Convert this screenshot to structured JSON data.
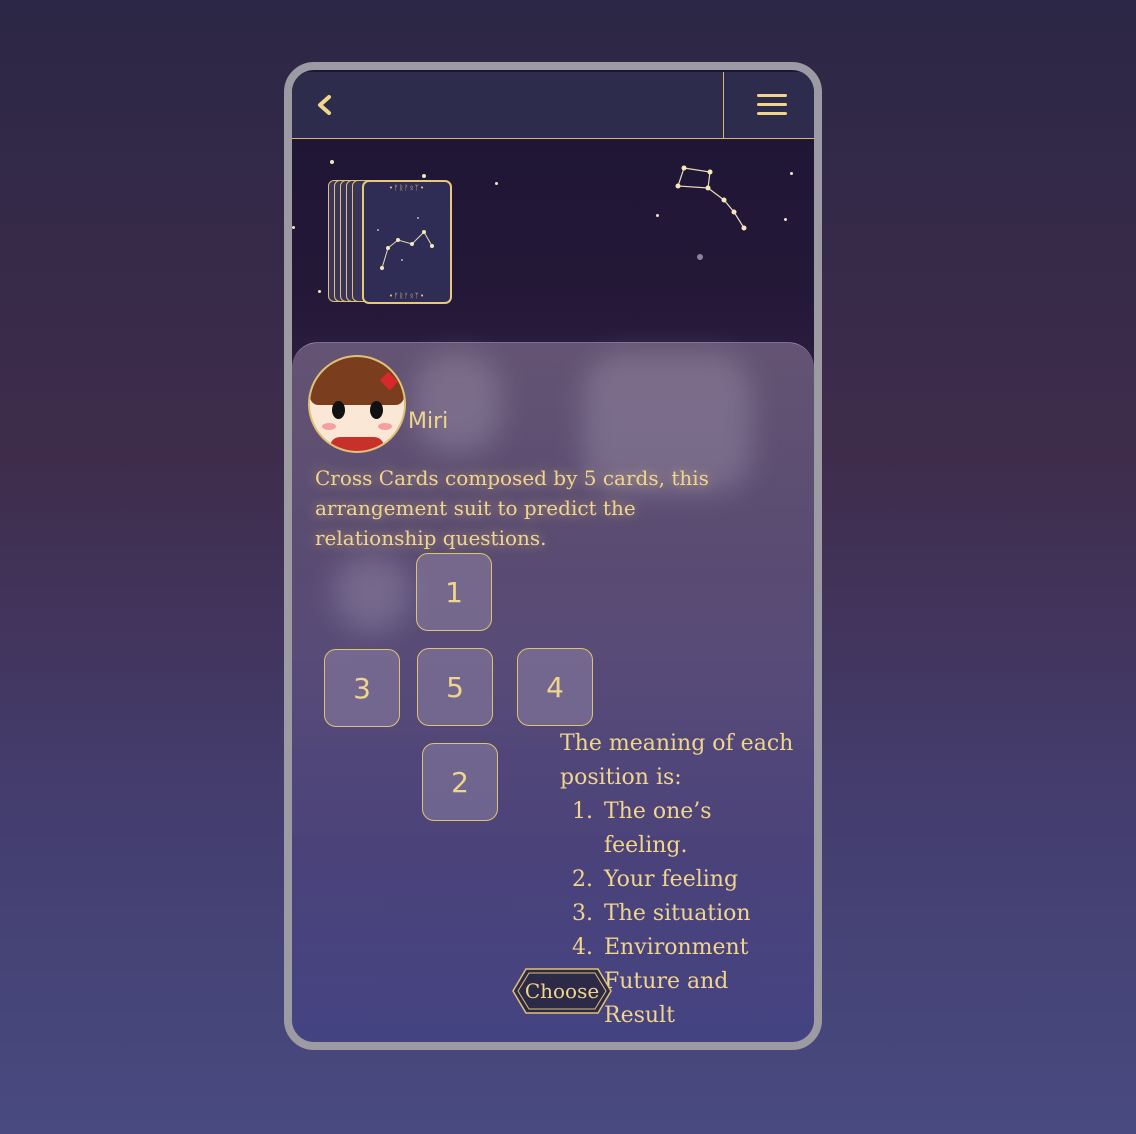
{
  "header": {
    "back_icon": "chevron-left-icon",
    "menu_icon": "hamburger-menu-icon"
  },
  "deck": {
    "runes_top": "•ᚠᚱᚨᛟᛉ•",
    "runes_bottom": "•ᚠᚱᚨᛟᛉ•"
  },
  "speaker": {
    "name": "Miri"
  },
  "description": "Cross Cards composed by 5 cards, this arrangement suit to predict the relationship questions.",
  "slots": [
    "1",
    "3",
    "5",
    "4",
    "2"
  ],
  "meaning": {
    "heading": "The meaning of each position is:",
    "items": [
      "The one’s feeling.",
      "Your feeling",
      "The situation",
      "Environment",
      "Future and Result"
    ]
  },
  "choose_button": {
    "label": "Choose"
  },
  "colors": {
    "gold": "#f1d58d",
    "topbar": "#2e2c4d",
    "frame": "#9c9aa3"
  }
}
